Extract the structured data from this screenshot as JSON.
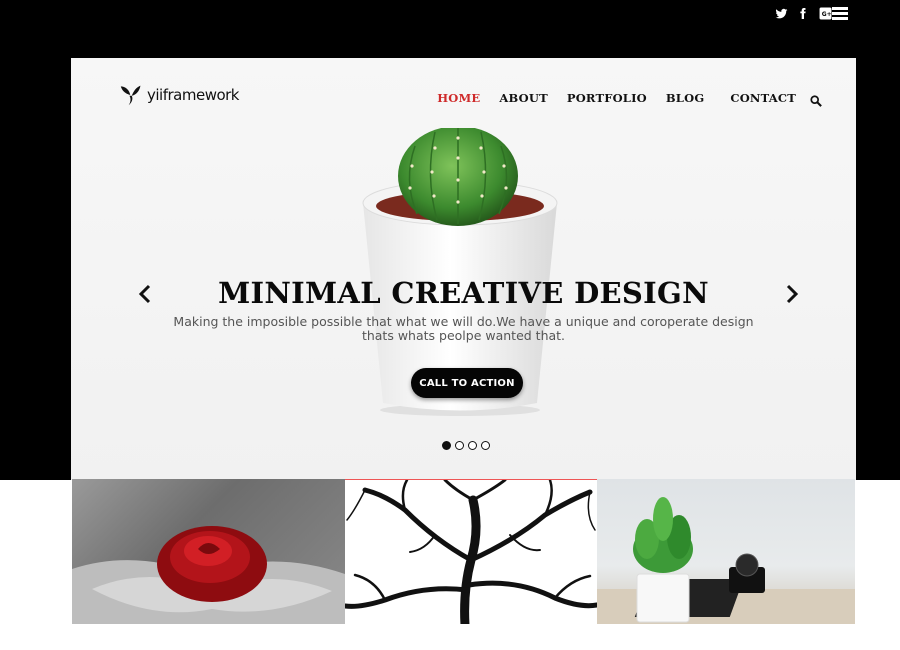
{
  "social": {
    "icons": [
      "twitter-icon",
      "facebook-icon",
      "google-plus-icon"
    ],
    "menu_icon": "hamburger-menu-icon"
  },
  "brand": {
    "logo_text": "yiiframework"
  },
  "nav": {
    "items": [
      {
        "label": "HOME",
        "active": true
      },
      {
        "label": "ABOUT",
        "active": false
      },
      {
        "label": "PORTFOLIO",
        "active": false
      },
      {
        "label": "BLOG",
        "active": false
      },
      {
        "label": "CONTACT",
        "active": false
      }
    ],
    "search_icon": "search-icon",
    "active_color": "#cf2b2b"
  },
  "hero": {
    "title": "MINIMAL CREATIVE DESIGN",
    "subtitle": "Making the imposible possible that what we will do.We have a unique and coroperate design thats whats peolpe wanted that.",
    "cta_label": "CALL TO ACTION",
    "slides_total": 4,
    "slides_active_index": 0
  },
  "gallery": {
    "tiles": [
      "rose-in-hands-image",
      "tree-branches-image",
      "potted-plant-camera-image"
    ]
  }
}
